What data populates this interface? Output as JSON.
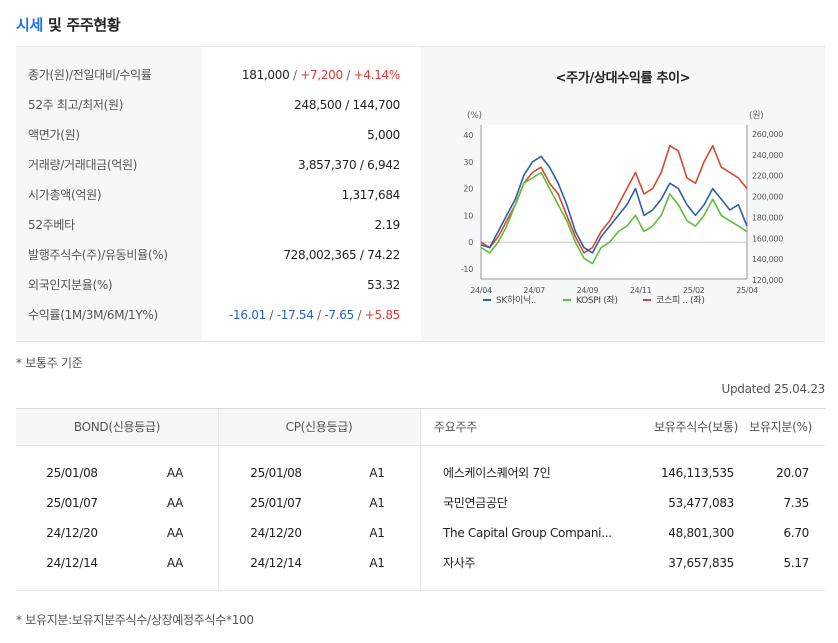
{
  "title": {
    "highlight": "시세",
    "rest": " 및 주주현황"
  },
  "summary": {
    "rows": [
      {
        "label": "종가(원)/전일대비/수익률",
        "parts": [
          {
            "text": "181,000",
            "color": "default"
          },
          {
            "text": " / ",
            "color": "sep"
          },
          {
            "text": "+7,200",
            "color": "red"
          },
          {
            "text": " / ",
            "color": "sep"
          },
          {
            "text": "+4.14%",
            "color": "red"
          }
        ]
      },
      {
        "label": "52주 최고/최저(원)",
        "parts": [
          {
            "text": "248,500 / 144,700",
            "color": "default"
          }
        ]
      },
      {
        "label": "액면가(원)",
        "parts": [
          {
            "text": "5,000",
            "color": "default"
          }
        ]
      },
      {
        "label": "거래량/거래대금(억원)",
        "parts": [
          {
            "text": "3,857,370 / 6,942",
            "color": "default"
          }
        ]
      },
      {
        "label": "시가총액(억원)",
        "parts": [
          {
            "text": "1,317,684",
            "color": "default"
          }
        ]
      },
      {
        "label": "52주베타",
        "parts": [
          {
            "text": "2.19",
            "color": "default"
          }
        ]
      },
      {
        "label": "발행주식수(주)/유동비율(%)",
        "parts": [
          {
            "text": "728,002,365 / 74.22",
            "color": "default"
          }
        ]
      },
      {
        "label": "외국인지분율(%)",
        "parts": [
          {
            "text": "53.32",
            "color": "default"
          }
        ]
      },
      {
        "label": "수익률(1M/3M/6M/1Y%)",
        "parts": [
          {
            "text": "-16.01",
            "color": "blue"
          },
          {
            "text": " / ",
            "color": "sep"
          },
          {
            "text": "-17.54",
            "color": "blue"
          },
          {
            "text": " / ",
            "color": "sep"
          },
          {
            "text": "-7.65",
            "color": "blue"
          },
          {
            "text": " / ",
            "color": "sep"
          },
          {
            "text": "+5.85",
            "color": "red"
          }
        ]
      }
    ]
  },
  "chart_data": {
    "type": "line",
    "title": "<주가/상대수익률 추이>",
    "left_unit": "(%)",
    "right_unit": "(원)",
    "x_ticks": [
      "24/04",
      "24/07",
      "24/09",
      "24/11",
      "25/02",
      "25/04"
    ],
    "ylim_left": [
      -10,
      40
    ],
    "y_ticks_left": [
      "40",
      "30",
      "20",
      "10",
      "0",
      "-10"
    ],
    "ylim_right": [
      120000,
      260000
    ],
    "y_ticks_right": [
      "260,000",
      "240,000",
      "220,000",
      "200,000",
      "180,000",
      "160,000",
      "140,000",
      "120,000"
    ],
    "grid": "baseline-at-0",
    "legend_position": "bottom",
    "series": [
      {
        "name": "SK하이닉..",
        "color": "#2f5fa8",
        "values": [
          -1,
          -2,
          4,
          10,
          16,
          25,
          30,
          32,
          28,
          22,
          14,
          4,
          -2,
          -4,
          2,
          6,
          10,
          14,
          20,
          10,
          12,
          16,
          22,
          20,
          14,
          10,
          14,
          20,
          16,
          12,
          14,
          6
        ]
      },
      {
        "name": "KOSPI (좌)",
        "color": "#5cbf3a",
        "values": [
          -2,
          -4,
          0,
          6,
          14,
          22,
          24,
          26,
          20,
          14,
          8,
          0,
          -6,
          -8,
          -2,
          0,
          4,
          6,
          10,
          4,
          6,
          10,
          18,
          14,
          8,
          6,
          10,
          16,
          10,
          8,
          6,
          4
        ]
      },
      {
        "name": "코스피 .. (좌)",
        "color": "#d94830",
        "values": [
          0,
          -2,
          2,
          8,
          14,
          22,
          26,
          28,
          22,
          18,
          10,
          2,
          -4,
          -2,
          4,
          8,
          14,
          20,
          26,
          18,
          20,
          26,
          36,
          34,
          24,
          22,
          30,
          36,
          28,
          26,
          24,
          20
        ]
      }
    ]
  },
  "note1": "* 보통주 기준",
  "updated": "Updated 25.04.23",
  "ratings": {
    "bond_header": "BOND(신용등급)",
    "cp_header": "CP(신용등급)",
    "bond": [
      {
        "date": "25/01/08",
        "grade": "AA"
      },
      {
        "date": "25/01/07",
        "grade": "AA"
      },
      {
        "date": "24/12/20",
        "grade": "AA"
      },
      {
        "date": "24/12/14",
        "grade": "AA"
      }
    ],
    "cp": [
      {
        "date": "25/01/08",
        "grade": "A1"
      },
      {
        "date": "25/01/07",
        "grade": "A1"
      },
      {
        "date": "24/12/20",
        "grade": "A1"
      },
      {
        "date": "24/12/14",
        "grade": "A1"
      }
    ]
  },
  "holders": {
    "headers": {
      "name": "주요주주",
      "shares": "보유주식수(보통)",
      "ratio": "보유지분(%)"
    },
    "rows": [
      {
        "name": "에스케이스퀘어외 7인",
        "shares": "146,113,535",
        "ratio": "20.07"
      },
      {
        "name": "국민연금공단",
        "shares": "53,477,083",
        "ratio": "7.35"
      },
      {
        "name": "The Capital Group Compani...",
        "shares": "48,801,300",
        "ratio": "6.70"
      },
      {
        "name": "자사주",
        "shares": "37,657,835",
        "ratio": "5.17"
      }
    ]
  },
  "note2": "* 보유지분:보유지분주식수/상장예정주식수*100"
}
